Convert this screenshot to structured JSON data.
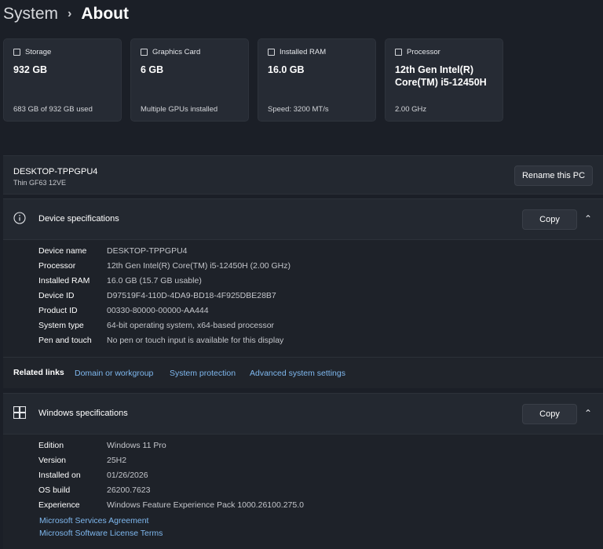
{
  "breadcrumb": {
    "root": "System",
    "separator": "›",
    "current": "About"
  },
  "cards": [
    {
      "icon": "storage-icon",
      "label": "Storage",
      "value": "932 GB",
      "sub": "683 GB of 932 GB used"
    },
    {
      "icon": "graphics-card-icon",
      "label": "Graphics Card",
      "value": "6 GB",
      "sub": "Multiple GPUs installed"
    },
    {
      "icon": "ram-icon",
      "label": "Installed RAM",
      "value": "16.0 GB",
      "sub": "Speed: 3200 MT/s"
    },
    {
      "icon": "processor-icon",
      "label": "Processor",
      "value": "12th Gen Intel(R) Core(TM) i5-12450H",
      "sub": "2.00 GHz"
    }
  ],
  "pc": {
    "name": "DESKTOP-TPPGPU4",
    "model": "Thin GF63 12VE",
    "rename_label": "Rename this PC"
  },
  "device_specs": {
    "title": "Device specifications",
    "copy_label": "Copy",
    "chevron": "^",
    "rows": [
      {
        "key": "Device name",
        "value": "DESKTOP-TPPGPU4"
      },
      {
        "key": "Processor",
        "value": "12th Gen Intel(R) Core(TM) i5-12450H (2.00 GHz)"
      },
      {
        "key": "Installed RAM",
        "value": "16.0 GB (15.7 GB usable)"
      },
      {
        "key": "Device ID",
        "value": "D97519F4-110D-4DA9-BD18-4F925DBE28B7"
      },
      {
        "key": "Product ID",
        "value": "00330-80000-00000-AA444"
      },
      {
        "key": "System type",
        "value": "64-bit operating system, x64-based processor"
      },
      {
        "key": "Pen and touch",
        "value": "No pen or touch input is available for this display"
      }
    ]
  },
  "related": {
    "label": "Related links",
    "links": [
      "Domain or workgroup",
      "System protection",
      "Advanced system settings"
    ]
  },
  "windows_specs": {
    "title": "Windows specifications",
    "copy_label": "Copy",
    "chevron": "^",
    "rows": [
      {
        "key": "Edition",
        "value": "Windows 11 Pro"
      },
      {
        "key": "Version",
        "value": "25H2"
      },
      {
        "key": "Installed on",
        "value": "01/26/2026"
      },
      {
        "key": "OS build",
        "value": "26200.7623"
      },
      {
        "key": "Experience",
        "value": "Windows Feature Experience Pack 1000.26100.275.0"
      }
    ],
    "links": [
      "Microsoft Services Agreement",
      "Microsoft Software License Terms"
    ]
  },
  "colors": {
    "background": "#1b1f27",
    "panel": "#232830",
    "link": "#7fb8ef"
  }
}
